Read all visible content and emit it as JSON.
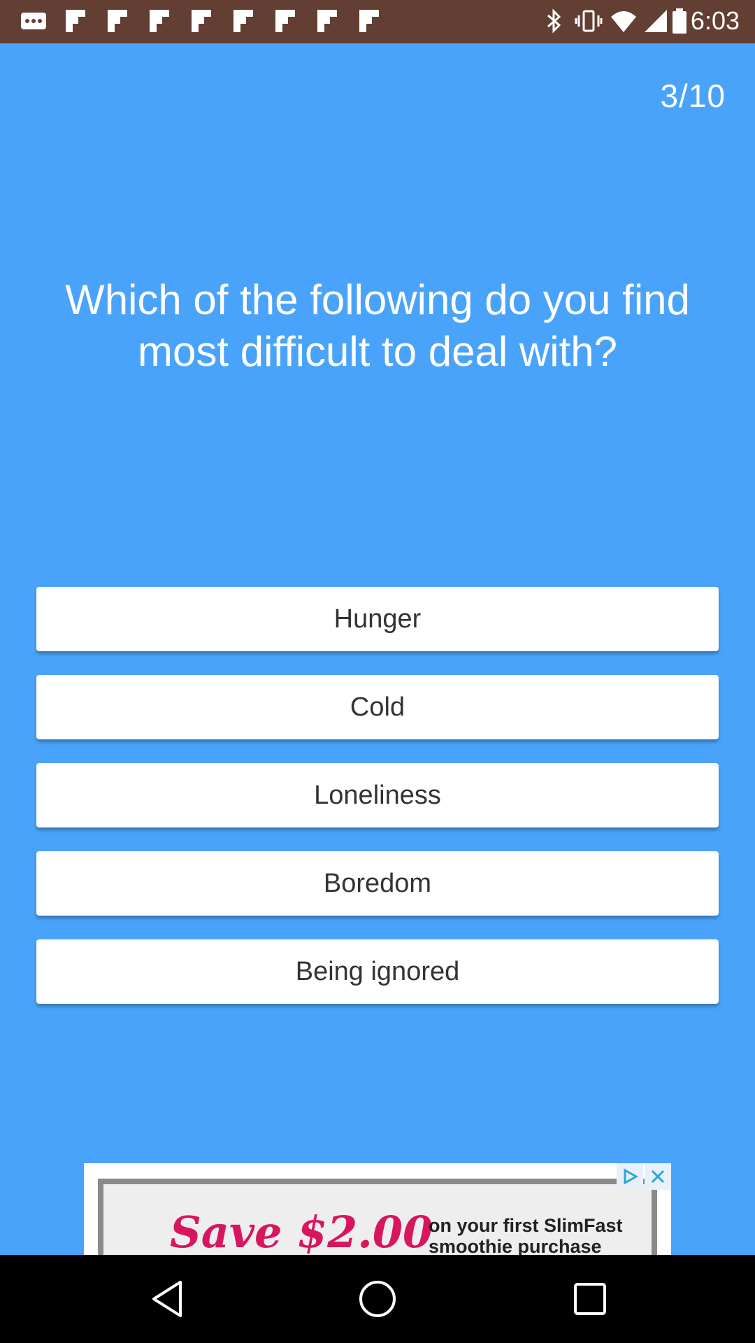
{
  "status_bar": {
    "time": "6:03",
    "icons": [
      "more-icon",
      "flipboard-icon",
      "flipboard-icon",
      "flipboard-icon",
      "flipboard-icon",
      "flipboard-icon",
      "flipboard-icon",
      "flipboard-icon",
      "flipboard-icon",
      "bluetooth-icon",
      "vibrate-icon",
      "wifi-icon",
      "signal-icon",
      "battery-icon"
    ]
  },
  "quiz": {
    "progress": "3/10",
    "question": "Which of the following do you find most difficult to deal with?",
    "options": [
      "Hunger",
      "Cold",
      "Loneliness",
      "Boredom",
      "Being ignored"
    ]
  },
  "ad": {
    "headline": "Save $2.00",
    "subtext": "on your first SlimFast smoothie purchase",
    "accent": "#d8155f"
  },
  "nav_bar": {
    "buttons": [
      "back-icon",
      "home-icon",
      "recents-icon"
    ]
  },
  "colors": {
    "background": "#4aa3fa",
    "status_bar": "#633e32",
    "option_bg": "#ffffff",
    "option_text": "#333333"
  }
}
